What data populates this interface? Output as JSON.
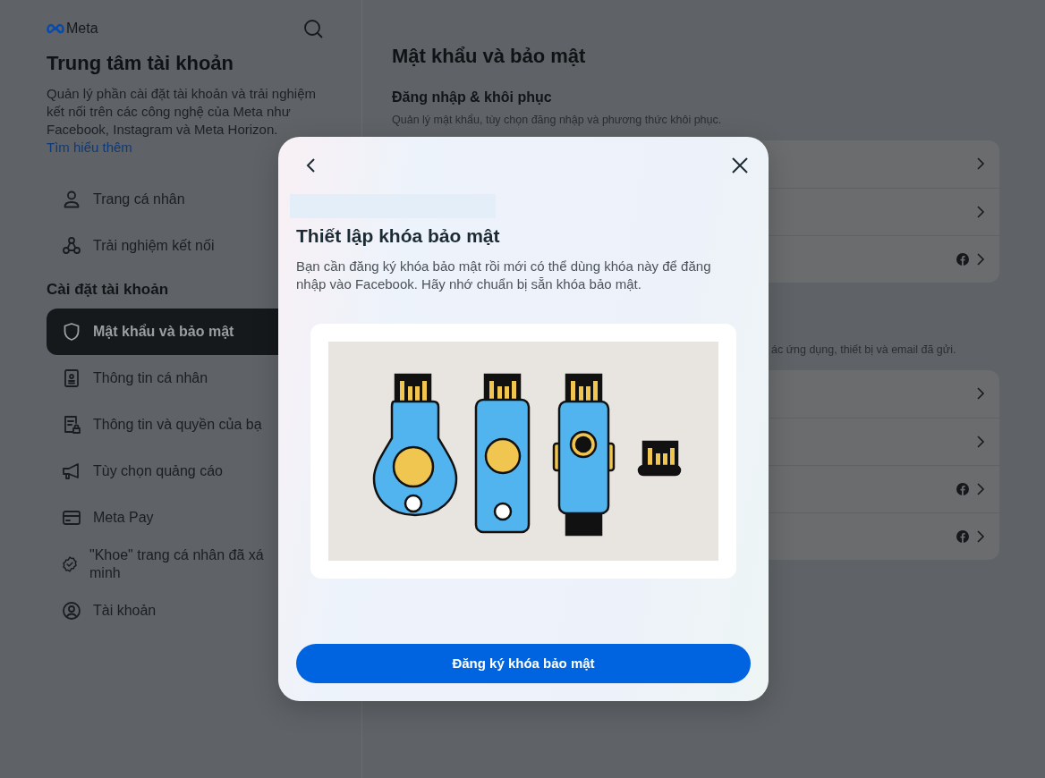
{
  "sidebar": {
    "logo": "Meta",
    "title": "Trung tâm tài khoản",
    "description": "Quản lý phần cài đặt tài khoản và trải nghiệm kết nối trên các công nghệ của Meta như Facebook, Instagram và Meta Horizon.",
    "link": "Tìm hiểu thêm",
    "primary_items": [
      {
        "label": "Trang cá nhân",
        "selected": false
      },
      {
        "label": "Trải nghiệm kết nối",
        "selected": false
      }
    ],
    "section": {
      "heading": "Cài đặt tài khoản",
      "items": [
        {
          "label": "Mật khẩu và bảo mật",
          "selected": true
        },
        {
          "label": "Thông tin cá nhân",
          "selected": false
        },
        {
          "label": "Thông tin và quyền của bạ",
          "selected": false
        },
        {
          "label": "Tùy chọn quảng cáo",
          "selected": false
        },
        {
          "label": "Meta Pay",
          "selected": false
        },
        {
          "label": "\"Khoe\" trang cá nhân đã xá minh",
          "selected": false
        },
        {
          "label": "Tài khoản",
          "selected": false
        }
      ]
    }
  },
  "main": {
    "title": "Mật khẩu và bảo mật",
    "sections": [
      {
        "heading": "Đăng nhập & khôi phục",
        "description": "Quản lý mật khẩu, tùy chọn đăng nhập và phương thức khôi phục.",
        "rows": [
          {
            "facebook_icon": false
          },
          {
            "facebook_icon": false
          },
          {
            "facebook_icon": true
          }
        ]
      },
      {
        "description": "ác ứng dụng, thiết bị và email đã gửi.",
        "rows": [
          {
            "facebook_icon": false
          },
          {
            "facebook_icon": false
          },
          {
            "facebook_icon": true
          },
          {
            "facebook_icon": true
          }
        ]
      }
    ]
  },
  "modal": {
    "title": "Thiết lập khóa bảo mật",
    "description": "Bạn cần đăng ký khóa bảo mật rồi mới có thể dùng khóa này để đăng nhập vào Facebook. Hãy nhớ chuẩn bị sẵn khóa bảo mật.",
    "button": "Đăng ký khóa bảo mật"
  }
}
